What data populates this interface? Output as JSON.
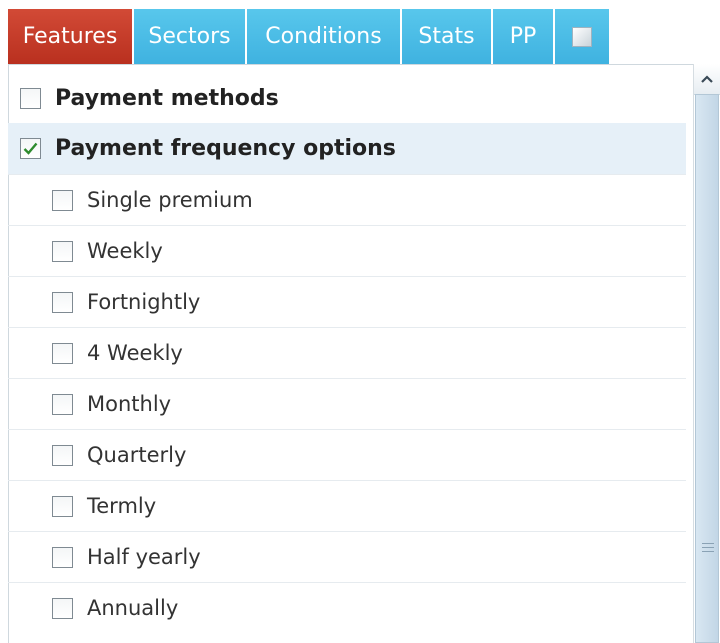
{
  "tabs": [
    {
      "label": "Features",
      "active": true
    },
    {
      "label": "Sectors",
      "active": false
    },
    {
      "label": "Conditions",
      "active": false
    },
    {
      "label": "Stats",
      "active": false
    },
    {
      "label": "PP",
      "active": false
    }
  ],
  "tab_extra_icon": "document-icon",
  "groups": [
    {
      "label": "Payment methods",
      "checked": false
    },
    {
      "label": "Payment frequency options",
      "checked": true
    }
  ],
  "options": [
    {
      "label": "Single premium",
      "checked": false
    },
    {
      "label": "Weekly",
      "checked": false
    },
    {
      "label": "Fortnightly",
      "checked": false
    },
    {
      "label": "4 Weekly",
      "checked": false
    },
    {
      "label": "Monthly",
      "checked": false
    },
    {
      "label": "Quarterly",
      "checked": false
    },
    {
      "label": "Termly",
      "checked": false
    },
    {
      "label": "Half yearly",
      "checked": false
    },
    {
      "label": "Annually",
      "checked": false
    }
  ],
  "colors": {
    "tab_active": "#c23a27",
    "tab_inactive": "#4bbbe6",
    "selected_row": "#e6f0f8",
    "check": "#2e8b2e"
  }
}
